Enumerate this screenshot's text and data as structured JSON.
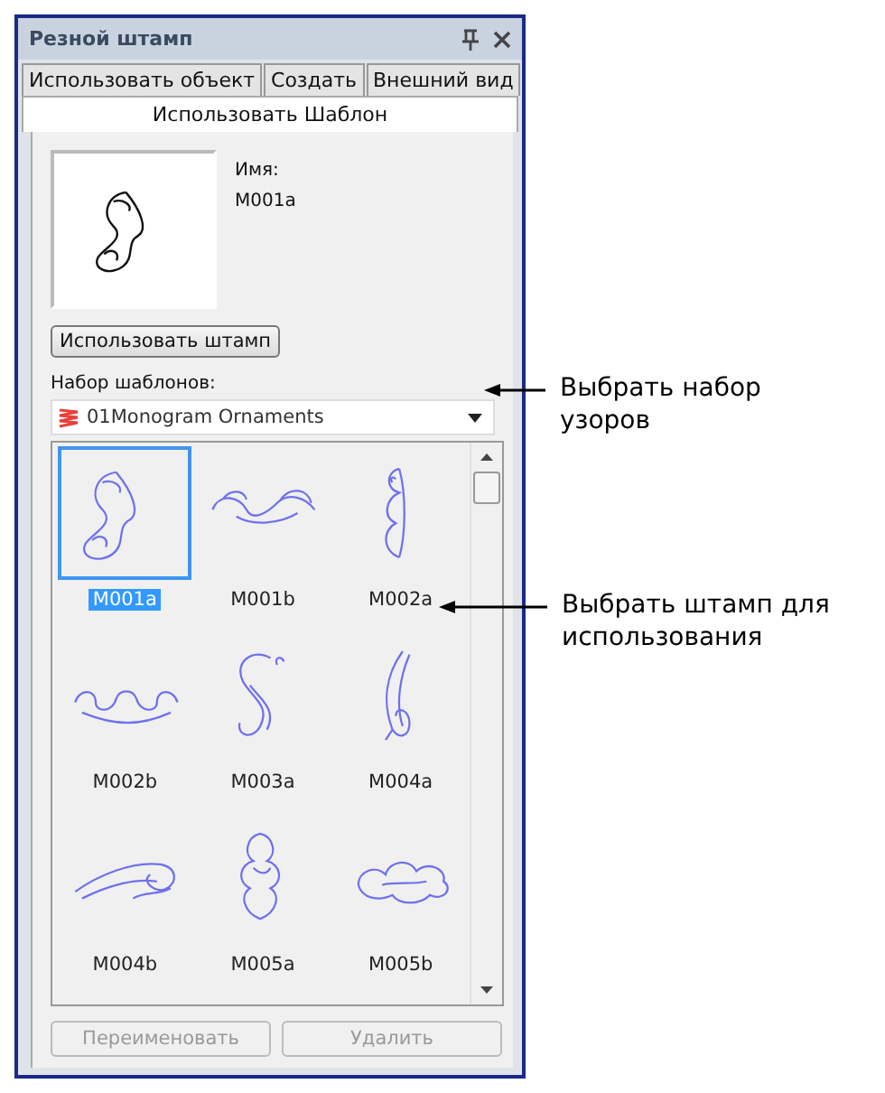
{
  "panel": {
    "title": "Резной штамп"
  },
  "tabs": [
    {
      "label": "Использовать объект",
      "selected": false
    },
    {
      "label": "Создать",
      "selected": false
    },
    {
      "label": "Внешний вид",
      "selected": false
    },
    {
      "label": "Использовать Шаблон",
      "selected": true
    }
  ],
  "preview": {
    "name_label": "Имя:",
    "name_value": "M001a"
  },
  "use_button": "Использовать штамп",
  "pattern_set": {
    "label": "Набор шаблонов:",
    "value": "01Monogram Ornaments"
  },
  "stamps": [
    {
      "name": "M001a",
      "selected": true
    },
    {
      "name": "M001b",
      "selected": false
    },
    {
      "name": "M002a",
      "selected": false
    },
    {
      "name": "M002b",
      "selected": false
    },
    {
      "name": "M003a",
      "selected": false
    },
    {
      "name": "M004a",
      "selected": false
    },
    {
      "name": "M004b",
      "selected": false
    },
    {
      "name": "M005a",
      "selected": false
    },
    {
      "name": "M005b",
      "selected": false
    }
  ],
  "buttons": [
    {
      "label": "Переименовать",
      "disabled": true
    },
    {
      "label": "Удалить",
      "disabled": true
    }
  ],
  "callouts": [
    {
      "text": "Выбрать набор узоров"
    },
    {
      "text": "Выбрать штамп для использования"
    }
  ]
}
